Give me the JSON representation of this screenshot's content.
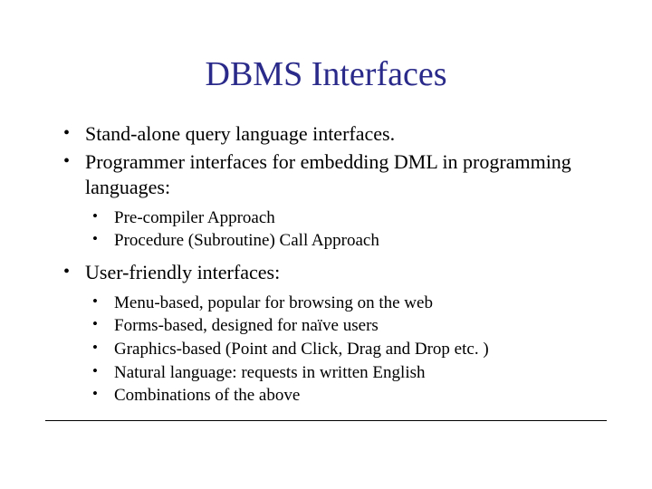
{
  "title": "DBMS Interfaces",
  "bullets": {
    "b1": "Stand-alone query language interfaces.",
    "b2": "Programmer interfaces for embedding DML in programming languages:",
    "b2_sub": {
      "s1": "Pre-compiler Approach",
      "s2": "Procedure (Subroutine) Call Approach"
    },
    "b3": "User-friendly interfaces:",
    "b3_sub": {
      "s1": "Menu-based, popular for browsing on the web",
      "s2": "Forms-based, designed for naïve users",
      "s3": "Graphics-based (Point and Click, Drag and Drop etc. )",
      "s4": "Natural language: requests in written English",
      "s5": "Combinations of the above"
    }
  }
}
